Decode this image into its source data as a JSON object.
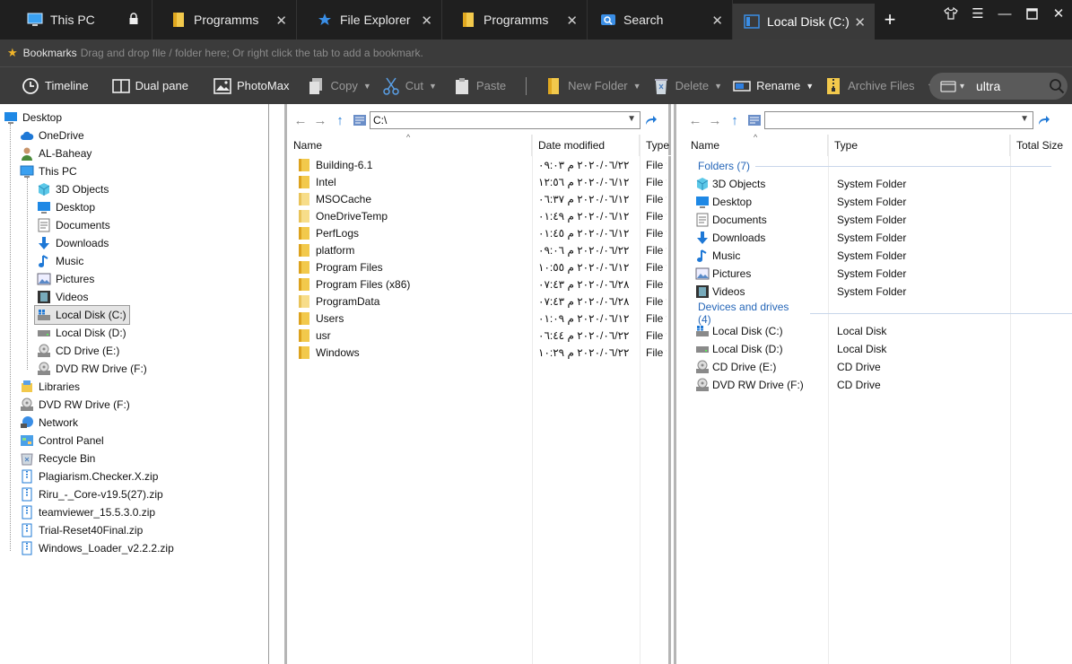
{
  "tabs": [
    {
      "label": "This PC",
      "icon": "monitor-icon",
      "locked": true
    },
    {
      "label": "Programms",
      "icon": "folder-icon"
    },
    {
      "label": "File Explorer",
      "icon": "star-icon"
    },
    {
      "label": "Programms",
      "icon": "folder-icon"
    },
    {
      "label": "Search",
      "icon": "search-icon"
    },
    {
      "label": "Local Disk (C:)",
      "icon": "drive-icon",
      "active": true
    }
  ],
  "tab_close_glyph": "✕",
  "new_tab_glyph": "+",
  "bookmarks": {
    "title": "Bookmarks",
    "hint": "Drag and drop file / folder here; Or right click the tab to add a bookmark."
  },
  "toolbar": {
    "timeline": "Timeline",
    "dual_pane": "Dual pane",
    "photomax": "PhotoMax",
    "copy": "Copy",
    "cut": "Cut",
    "paste": "Paste",
    "new_folder": "New Folder",
    "delete": "Delete",
    "rename": "Rename",
    "archive": "Archive Files",
    "search_value": "ultra"
  },
  "tree": {
    "desktop": "Desktop",
    "onedrive": "OneDrive",
    "user": "AL-Baheay",
    "this_pc": "This PC",
    "pc_children": [
      "3D Objects",
      "Desktop",
      "Documents",
      "Downloads",
      "Music",
      "Pictures",
      "Videos",
      "Local Disk (C:)",
      "Local Disk (D:)",
      "CD Drive (E:)",
      "DVD RW Drive (F:)"
    ],
    "libraries": "Libraries",
    "dvd": "DVD RW Drive (F:)",
    "network": "Network",
    "control_panel": "Control Panel",
    "recycle_bin": "Recycle Bin",
    "zips": [
      "Plagiarism.Checker.X.zip",
      "Riru_-_Core-v19.5(27).zip",
      "teamviewer_15.5.3.0.zip",
      "Trial-Reset40Final.zip",
      "Windows_Loader_v2.2.2.zip"
    ]
  },
  "left_pane": {
    "address": "C:\\",
    "columns": {
      "name": "Name",
      "date": "Date modified",
      "type": "Type"
    },
    "rows": [
      {
        "name": "Building-6.1",
        "date": "٢٠٢٠/٠٦/٢٢ م ٠٩:٠٣",
        "type": "File f"
      },
      {
        "name": "Intel",
        "date": "٢٠٢٠/٠٦/١٢ م ١٢:٥٦",
        "type": "File f"
      },
      {
        "name": "MSOCache",
        "date": "٢٠٢٠/٠٦/١٢ م ٠٦:٣٧",
        "type": "File f"
      },
      {
        "name": "OneDriveTemp",
        "date": "٢٠٢٠/٠٦/١٢ م ٠١:٤٩",
        "type": "File f"
      },
      {
        "name": "PerfLogs",
        "date": "٢٠٢٠/٠٦/١٢ م ٠١:٤٥",
        "type": "File f"
      },
      {
        "name": "platform",
        "date": "٢٠٢٠/٠٦/٢٢ م ٠٩:٠٦",
        "type": "File f"
      },
      {
        "name": "Program Files",
        "date": "٢٠٢٠/٠٦/١٢ م ١٠:٥٥",
        "type": "File f"
      },
      {
        "name": "Program Files (x86)",
        "date": "٢٠٢٠/٠٦/٢٨ م ٠٧:٤٣",
        "type": "File f"
      },
      {
        "name": "ProgramData",
        "date": "٢٠٢٠/٠٦/٢٨ م ٠٧:٤٣",
        "type": "File f"
      },
      {
        "name": "Users",
        "date": "٢٠٢٠/٠٦/١٢ م ٠١:٠٩",
        "type": "File f"
      },
      {
        "name": "usr",
        "date": "٢٠٢٠/٠٦/٢٢ م ٠٦:٤٤",
        "type": "File f"
      },
      {
        "name": "Windows",
        "date": "٢٠٢٠/٠٦/٢٢ م ١٠:٢٩",
        "type": "File f"
      }
    ]
  },
  "right_pane": {
    "address": "",
    "columns": {
      "name": "Name",
      "type": "Type",
      "size": "Total Size"
    },
    "folders_group": "Folders (7)",
    "folders": [
      {
        "name": "3D Objects",
        "type": "System Folder",
        "icon": "cube-icon"
      },
      {
        "name": "Desktop",
        "type": "System Folder",
        "icon": "desktop-icon"
      },
      {
        "name": "Documents",
        "type": "System Folder",
        "icon": "document-icon"
      },
      {
        "name": "Downloads",
        "type": "System Folder",
        "icon": "download-icon"
      },
      {
        "name": "Music",
        "type": "System Folder",
        "icon": "music-icon"
      },
      {
        "name": "Pictures",
        "type": "System Folder",
        "icon": "picture-icon"
      },
      {
        "name": "Videos",
        "type": "System Folder",
        "icon": "video-icon"
      }
    ],
    "drives_group": "Devices and drives (4)",
    "drives": [
      {
        "name": "Local Disk (C:)",
        "type": "Local Disk",
        "icon": "windows-drive-icon"
      },
      {
        "name": "Local Disk (D:)",
        "type": "Local Disk",
        "icon": "drive-icon"
      },
      {
        "name": "CD Drive (E:)",
        "type": "CD Drive",
        "icon": "cd-drive-icon"
      },
      {
        "name": "DVD RW Drive (F:)",
        "type": "CD Drive",
        "icon": "dvd-drive-icon"
      }
    ]
  }
}
